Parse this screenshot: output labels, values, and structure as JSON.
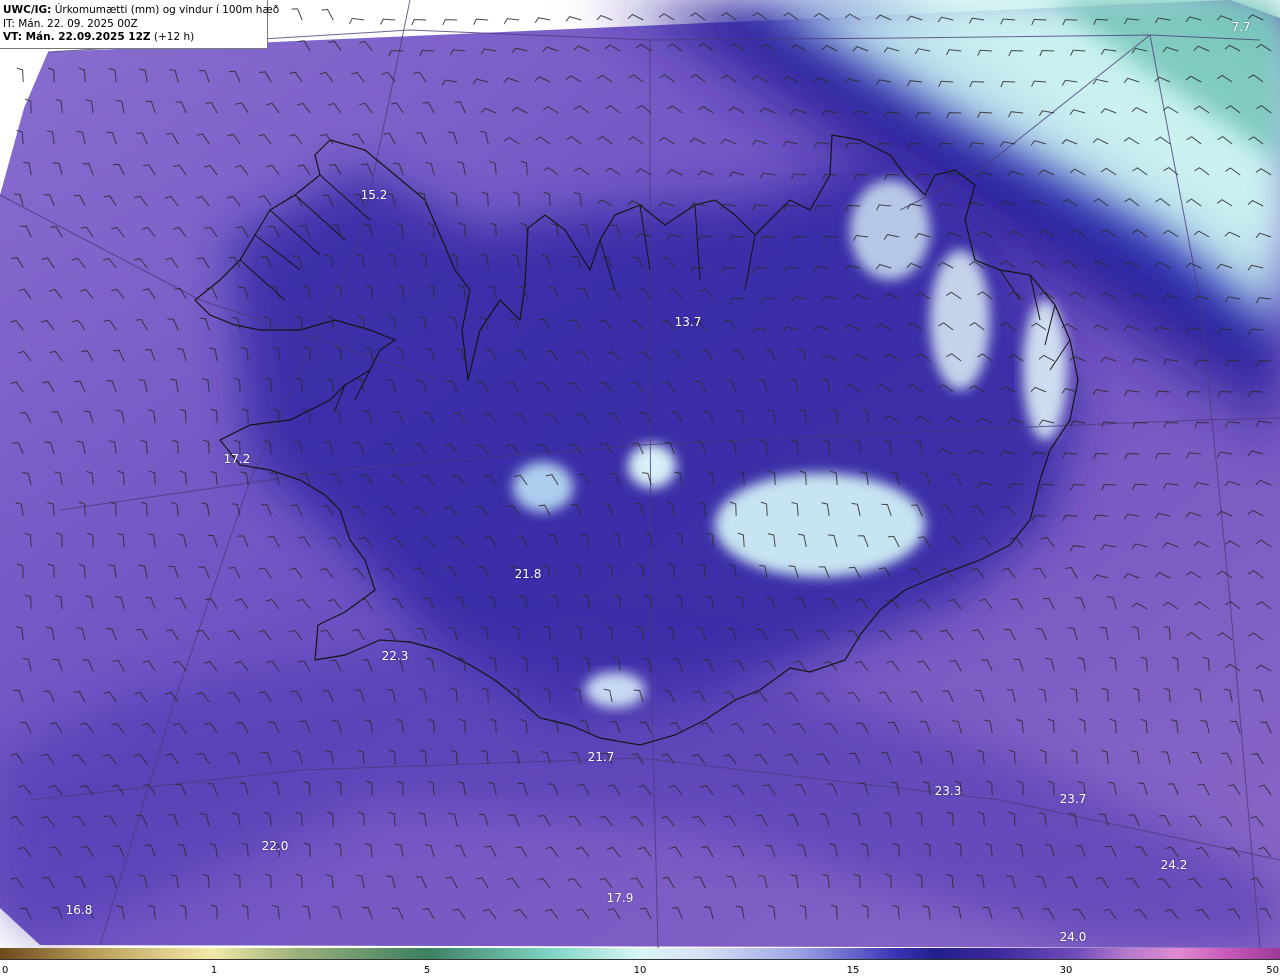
{
  "header": {
    "title_bold": "UWC/IG:",
    "title_rest": " Úrkomumætti (mm) og vindur í 100m hæð",
    "it_line": "IT: Mán. 22. 09. 2025 00Z",
    "vt_bold": "VT: Mán. 22.09.2025 12Z",
    "vt_rest": " (+12 h)"
  },
  "map_values": [
    {
      "label": "15.2"
    },
    {
      "label": "13.7"
    },
    {
      "label": "17.2"
    },
    {
      "label": "21.8"
    },
    {
      "label": "22.3"
    },
    {
      "label": "21.7"
    },
    {
      "label": "23.3"
    },
    {
      "label": "23.7"
    },
    {
      "label": "24.2"
    },
    {
      "label": "22.0"
    },
    {
      "label": "17.9"
    },
    {
      "label": "16.8"
    },
    {
      "label": "24.0"
    },
    {
      "label": "7.7"
    }
  ],
  "colorbar": {
    "ticks": [
      "0",
      "1",
      "5",
      "10",
      "15",
      "30",
      "50"
    ]
  },
  "colors": {
    "background_purple": "#7a5cc4",
    "deep_blue": "#2a1f9a",
    "light_cyan": "#cff3f3",
    "teal": "#6fc2b6",
    "coastline": "#1a1a1a",
    "wind_barb": "#2b2b2b"
  }
}
